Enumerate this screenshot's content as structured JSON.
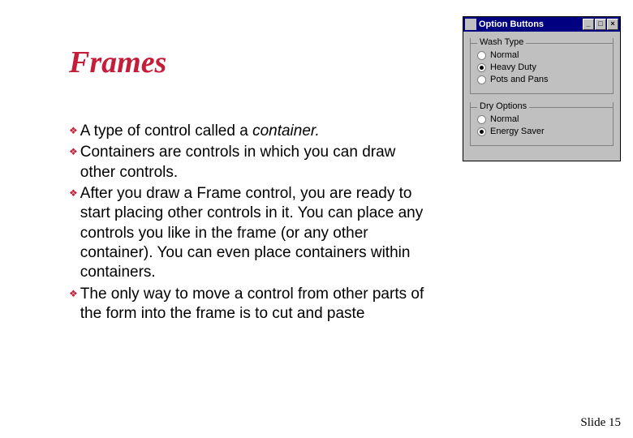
{
  "title": "Frames",
  "bullets": {
    "b0a": "A type of control called a ",
    "b0b": "container.",
    "b1": "Containers are controls in which you can draw other controls.",
    "b2": "After you draw a Frame control, you are ready to start placing other controls in it. You can place any controls you like in the frame (or any other container). You can even place containers within containers.",
    "b3": "The only way to move a control from other parts of the form into the frame is to cut and paste"
  },
  "footer": "Slide 15",
  "window": {
    "title": "Option Buttons",
    "min": "_",
    "max": "□",
    "close": "×",
    "frame1": {
      "title": "Wash Type",
      "opt0": "Normal",
      "opt1": "Heavy Duty",
      "opt2": "Pots and Pans",
      "selectedIndex": 1
    },
    "frame2": {
      "title": "Dry Options",
      "opt0": "Normal",
      "opt1": "Energy Saver",
      "selectedIndex": 1
    }
  }
}
